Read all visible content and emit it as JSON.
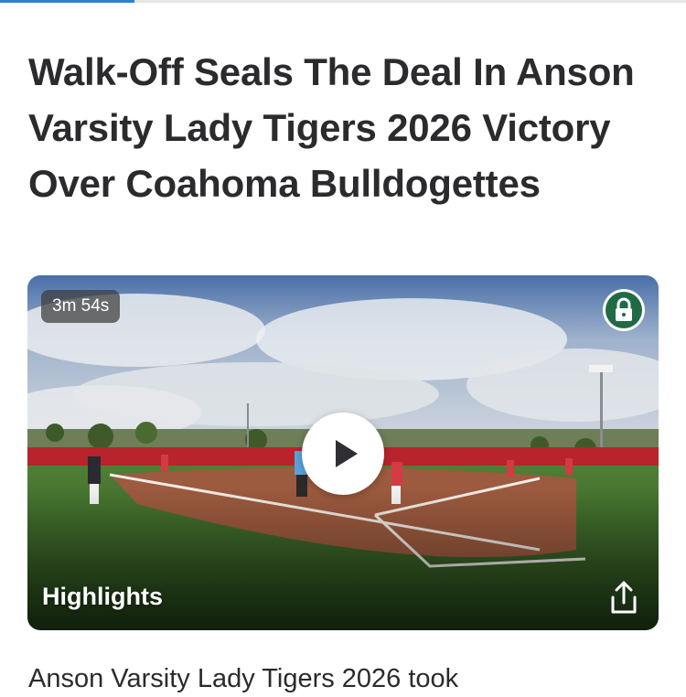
{
  "reading_progress": 0.196,
  "article": {
    "title": "Walk-Off Seals The Deal In Anson Varsity Lady Tigers 2026 Victory Over Coahoma Bulldogettes",
    "body_preview": "Anson Varsity Lady Tigers 2026 took"
  },
  "video": {
    "duration": "3m 54s",
    "label": "Highlights",
    "icons": {
      "lock": "lock-icon",
      "play": "play-icon",
      "share": "share-icon"
    }
  },
  "colors": {
    "accent": "#2f7fd8",
    "lock_badge": "#1f6b46",
    "title_text": "#2b2b2e"
  }
}
